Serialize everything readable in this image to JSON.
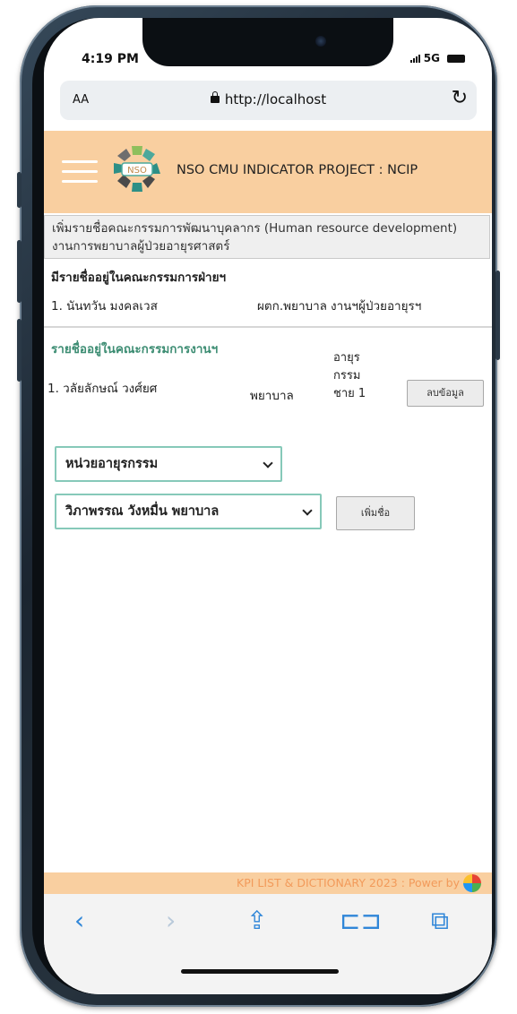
{
  "status": {
    "time": "4:19 PM",
    "network": "5G"
  },
  "browser": {
    "aa_label": "AA",
    "url": "http://localhost"
  },
  "header": {
    "logo_text": "NSO",
    "title": "NSO CMU INDICATOR PROJECT : NCIP"
  },
  "section": {
    "title": "เพิ่มรายชื่อคณะกรรมการพัฒนาบุคลากร (Human resource development) งานการพยาบาลผู้ป่วยอายุรศาสตร์"
  },
  "division_committee": {
    "title": "มีรายชื่ออยู่ในคณะกรรมการฝ่ายฯ",
    "members": [
      {
        "name": "1.  นันทวัน มงคลเวส",
        "position": "ผตก.พยาบาล",
        "unit": "งานฯผู้ป่วยอายุรฯ"
      }
    ]
  },
  "unit_committee": {
    "title": "รายชื่ออยู่ในคณะกรรมการงานฯ",
    "members": [
      {
        "name": "1. วลัยลักษณ์ วงศ์ยศ",
        "position": "พยาบาล",
        "unit_line1": "อายุร",
        "unit_line2": "กรรม",
        "unit_line3": "ชาย 1",
        "delete_label": "ลบข้อมูล"
      }
    ]
  },
  "form": {
    "department_selected": "หน่วยอายุรกรรม",
    "person_selected": "วิภาพรรณ วังหมื่น พยาบาล",
    "add_label": "เพิ่มชื่อ"
  },
  "footer": {
    "text": "KPI LIST & DICTIONARY 2023 : Power by"
  },
  "toolbar": {
    "back": "‹",
    "forward": "›",
    "share": "⇪",
    "bookmarks": "⊏⊐",
    "tabs": "⧉"
  }
}
